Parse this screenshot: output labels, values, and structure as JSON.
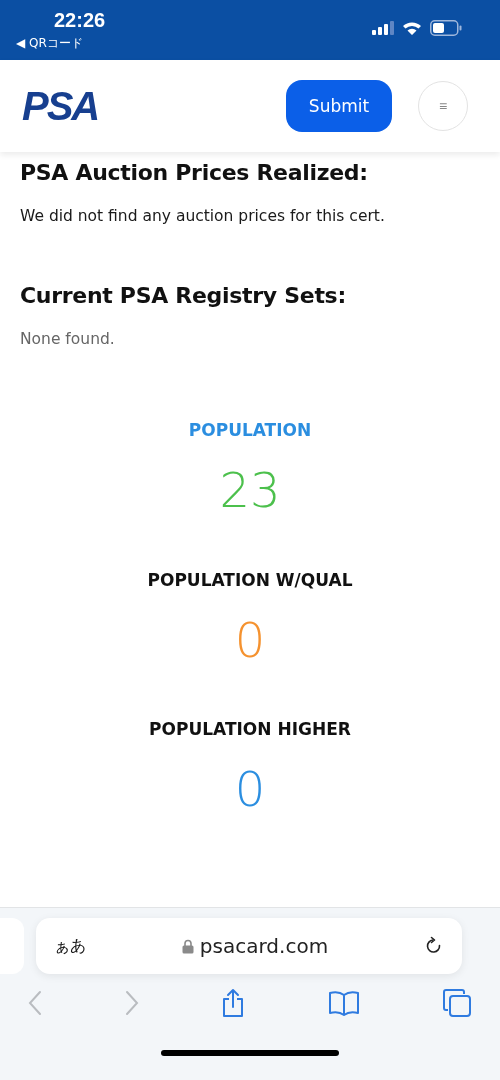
{
  "status_bar": {
    "time": "22:26",
    "back_link": "◀ QRコード"
  },
  "header": {
    "logo": "PSA",
    "submit_button": "Submit",
    "menu_button": "≡"
  },
  "sections": [
    {
      "title": "PSA Auction Prices Realized:",
      "text": "We did not find any auction prices for this cert.",
      "kind": "dark"
    },
    {
      "title": "Current PSA Registry Sets:",
      "text": "None found.",
      "kind": "muted"
    }
  ],
  "stats": [
    {
      "label": "POPULATION",
      "value": "23",
      "highlighted": true,
      "color": "#4cc04c"
    },
    {
      "label": "POPULATION W/QUAL",
      "value": "0",
      "highlighted": false,
      "color": "#f5922f"
    },
    {
      "label": "POPULATION HIGHER",
      "value": "0",
      "highlighted": false,
      "color": "#2b8ee0"
    }
  ],
  "browser": {
    "text_size_button": "ぁあ",
    "url": "psacard.com"
  }
}
